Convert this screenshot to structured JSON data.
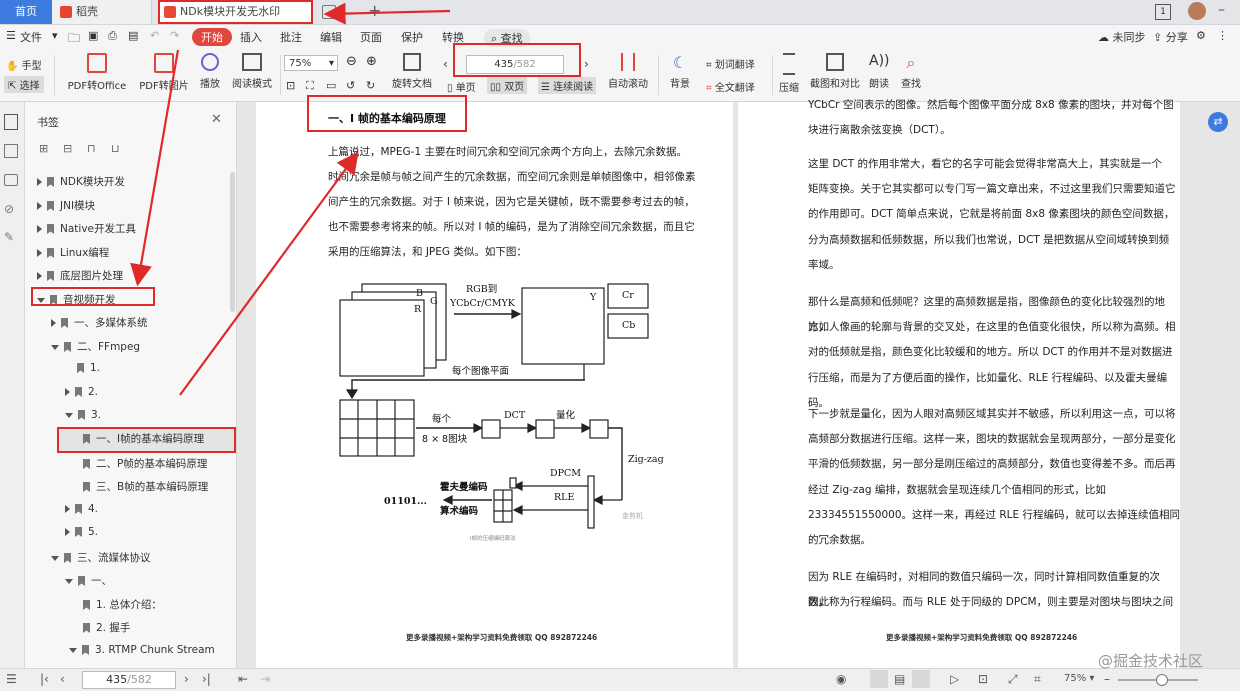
{
  "tabs": {
    "home": "首页",
    "doc": "稻壳",
    "pdf": "NDk模块开发无水印版.pdf"
  },
  "menu": {
    "file": "文件",
    "start": "开始",
    "insert": "插入",
    "annotate": "批注",
    "edit": "编辑",
    "page": "页面",
    "protect": "保护",
    "convert": "转换",
    "find": "查找",
    "unsync": "未同步",
    "share": "分享"
  },
  "ribbon": {
    "hand": "手型",
    "select": "选择",
    "pdf_office": "PDF转Office",
    "pdf_image": "PDF转图片",
    "play": "播放",
    "read_mode": "阅读模式",
    "zoom": "75%",
    "rotate": "旋转文档",
    "page_current": "435",
    "page_total": "/582",
    "single": "单页",
    "double": "双页",
    "continuous": "连续阅读",
    "auto_scroll": "自动滚动",
    "background": "背景",
    "word_translate": "划词翻译",
    "full_translate": "全文翻译",
    "compress": "压缩",
    "screenshot": "截图和对比",
    "read_aloud": "朗读",
    "search": "查找"
  },
  "sidebar": {
    "title": "书签",
    "items": [
      {
        "label": "NDK模块开发"
      },
      {
        "label": "JNI模块"
      },
      {
        "label": "Native开发工具"
      },
      {
        "label": "Linux编程"
      },
      {
        "label": "底层图片处理"
      },
      {
        "label": "音视频开发"
      },
      {
        "label": "一、多媒体系统"
      },
      {
        "label": "二、FFmpeg"
      },
      {
        "label": "1."
      },
      {
        "label": "2."
      },
      {
        "label": "3."
      },
      {
        "label": "一、I帧的基本编码原理"
      },
      {
        "label": "二、P帧的基本编码原理"
      },
      {
        "label": "三、B帧的基本编码原理"
      },
      {
        "label": "4."
      },
      {
        "label": "5."
      },
      {
        "label": "三、流媒体协议"
      },
      {
        "label": "一、"
      },
      {
        "label": "1. 总体介绍："
      },
      {
        "label": "2. 握手"
      },
      {
        "label": "3. RTMP Chunk Stream"
      }
    ]
  },
  "left_page": {
    "heading": "一、I 帧的基本编码原理",
    "lines": [
      "上篇说过，MPEG-1 主要在时间冗余和空间冗余两个方向上，去除冗余数据。",
      "时间冗余是帧与帧之间产生的冗余数据，而空间冗余则是单帧图像中，相邻像素",
      "间产生的冗余数据。对于 I 帧来说，因为它是关键帧，既不需要参考过去的帧，",
      "也不需要参考将来的帧。所以对 I 帧的编码，是为了消除空间冗余数据，而且它",
      "采用的压缩算法，和 JPEG 类似。如下图："
    ],
    "diagram": {
      "rgb_to": "RGB到",
      "ycbcr": "YCbCr/CMYK",
      "r": "R",
      "g": "G",
      "b": "B",
      "y": "Y",
      "cr": "Cr",
      "cb": "Cb",
      "each_plane": "每个图像平面",
      "each": "每个",
      "block": "8 × 8图块",
      "dct": "DCT",
      "quant": "量化",
      "zigzag": "Zig-zag",
      "dpcm": "DPCM",
      "rle": "RLE",
      "huffman": "霍夫曼编码",
      "arith": "算术编码",
      "bits": "01101...",
      "caption": "I帧的压缩编码算法",
      "watermark": "金剪机"
    },
    "footer": "更多录播视频+架构学习资料免费领取 QQ 892872246"
  },
  "right_page": {
    "paragraphs": [
      [
        "YCbCr 空间表示的图像。然后每个图像平面分成 8x8 像素的图块，并对每个图",
        "块进行离散余弦变换（DCT）。"
      ],
      [
        "这里 DCT 的作用非常大，看它的名字可能会觉得非常高大上，其实就是一个",
        "矩阵变换。关于它其实都可以专门写一篇文章出来，不过这里我们只需要知道它",
        "的作用即可。DCT 简单点来说，它就是将前面 8x8 像素图块的颜色空间数据，",
        "分为高频数据和低频数据，所以我们也常说，DCT 是把数据从空间域转换到频",
        "率域。"
      ],
      [
        "那什么是高频和低频呢？这里的高频数据是指，图像颜色的变化比较强烈的地方，",
        "比如人像画的轮廓与背景的交叉处，在这里的色值变化很快，所以称为高频。相",
        "对的低频就是指，颜色变化比较缓和的地方。所以 DCT 的作用并不是对数据进",
        "行压缩，而是为了方便后面的操作，比如量化、RLE 行程编码、以及霍夫曼编码。"
      ],
      [
        "下一步就是量化，因为人眼对高频区域其实并不敏感，所以利用这一点，可以将",
        "高频部分数据进行压缩。这样一来，图块的数据就会呈现两部分，一部分是变化",
        "平滑的低频数据，另一部分是刚压缩过的高频部分，数值也变得差不多。而后再",
        "经过 Zig-zag 编排，数据就会呈现连续几个值相同的形式，比如",
        "23334551550000。这样一来，再经过 RLE 行程编码，就可以去掉连续值相同",
        "的冗余数据。"
      ],
      [
        "因为 RLE 在编码时，对相同的数值只编码一次，同时计算相同数值重复的次数，",
        "因此称为行程编码。而与 RLE 处于同级的 DPCM，则主要是对图块与图块之间"
      ]
    ],
    "footer": "更多录播视频+架构学习资料免费领取 QQ 892872246"
  },
  "status": {
    "page_current": "435",
    "page_total": "/582",
    "zoom": "75%",
    "watermark": "@掘金技术社区"
  }
}
